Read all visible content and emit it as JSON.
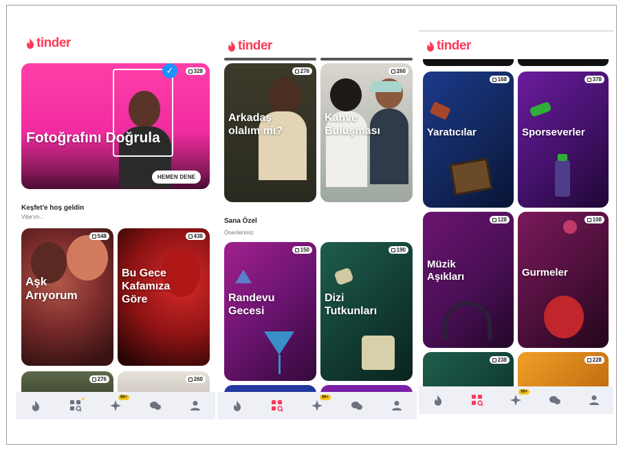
{
  "brand": {
    "logo_text": "tinder",
    "color": "#fd3a57"
  },
  "panels": [
    {
      "hero": {
        "title": "Fotoğrafını Doğrula",
        "badge": "328",
        "cta": "HEMEN DENE"
      },
      "section": {
        "title": "Keşfet'e hoş geldin",
        "subtitle": "Vibe'ım..."
      },
      "cards": [
        {
          "title_line1": "Aşk",
          "title_line2": "Arıyorum",
          "badge": "548"
        },
        {
          "title_line1": "Bu Gece",
          "title_line2": "Kafamıza",
          "title_line3": "Göre",
          "badge": "438"
        },
        {
          "badge": "276"
        },
        {
          "badge": "260"
        }
      ],
      "nav": {
        "badge": "99+"
      }
    },
    {
      "cards_top": [
        {
          "title_line1": "Arkadaş",
          "title_line2": "olalım mı?",
          "badge": "276"
        },
        {
          "title_line1": "Kahve",
          "title_line2": "Buluşması",
          "badge": "260"
        }
      ],
      "section": {
        "title": "Sana Özel",
        "subtitle": "Önerilerimiz"
      },
      "cards": [
        {
          "title_line1": "Randevu",
          "title_line2": "Gecesi",
          "badge": "150"
        },
        {
          "title_line1": "Dizi",
          "title_line2": "Tutkunları",
          "badge": "190"
        }
      ],
      "nav": {
        "badge": "99+"
      }
    },
    {
      "cards": [
        {
          "title_line1": "Yaratıcılar",
          "badge": "168"
        },
        {
          "title_line1": "Sporseverler",
          "badge": "378"
        },
        {
          "title_line1": "Müzik",
          "title_line2": "Aşıkları",
          "badge": "128"
        },
        {
          "title_line1": "Gurmeler",
          "badge": "108"
        },
        {
          "badge": "238"
        },
        {
          "badge": "228"
        }
      ],
      "nav": {
        "badge": "99+"
      }
    }
  ],
  "nav_icons": [
    "flame-icon",
    "explore-grid-icon",
    "sparkle-icon",
    "chat-bubbles-icon",
    "profile-icon"
  ]
}
